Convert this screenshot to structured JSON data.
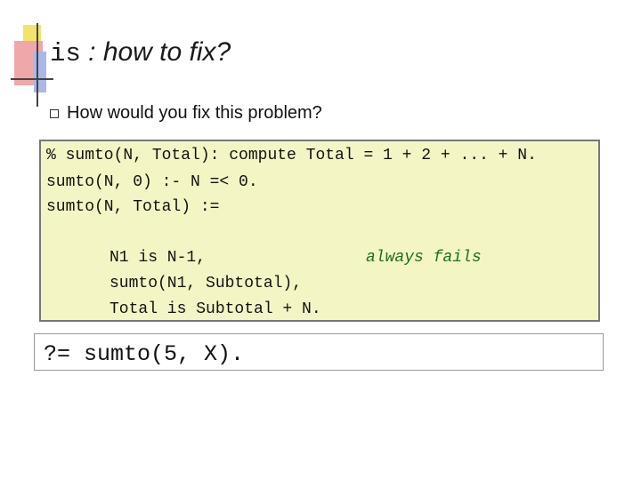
{
  "slide": {
    "title_mono": "is",
    "title_text": " : how to fix?",
    "bullet": "How would you fix this problem?",
    "code_lines": [
      "% sumto(N, Total): compute Total = 1 + 2 + ... + N.",
      "sumto(N, 0) :- N =< 0.",
      "sumto(N, Total) :=",
      "N1 is N-1,",
      "sumto(N1, Subtotal),",
      "Total is Subtotal + N."
    ],
    "annotation": "always fails",
    "query": "?= sumto(5, X)."
  },
  "colors": {
    "code_background": "#f3f5c4",
    "annotation": "#1f6f1f"
  }
}
